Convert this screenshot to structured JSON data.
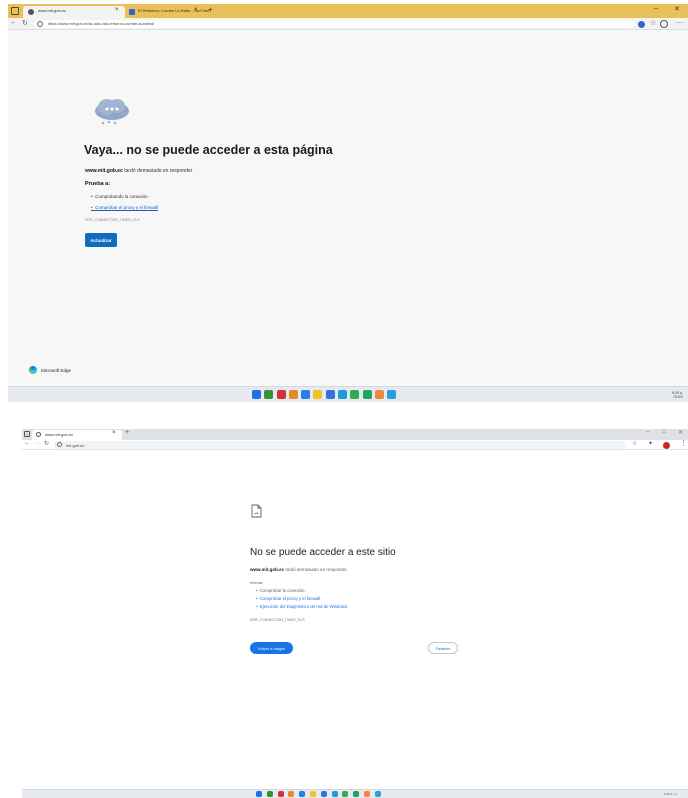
{
  "colors": {
    "edge_titlebar": "#e8c15a",
    "edge_button": "#0f6cbd",
    "chrome_button": "#1a73e8",
    "link": "#1a5fb4",
    "taskbar": "#e6e9ee"
  },
  "edge": {
    "tabs": [
      {
        "label": "www.mit.gob.ec",
        "icon": "globe-icon"
      },
      {
        "label": "El Refuerzo: Cumbe La Raba - YouTube",
        "icon": "tab-icon"
      }
    ],
    "address": "https://www.mit.gob.ec/la-ruta-vial-refuerzo-cumbe-la-batea/",
    "error": {
      "title": "Vaya... no se puede acceder a esta página",
      "host": "www.mit.gob.ec",
      "message": " tardó demasiado en responder",
      "try_label": "Prueba a:",
      "suggestions": [
        "Comprobando la conexión",
        "Comprobar el proxy y el firewall"
      ],
      "code": "ERR_CONNECTION_TIMED_OUT",
      "button": "Actualizar"
    },
    "brand": "Microsoft Edge",
    "clock": {
      "time": "9:29 a.",
      "date": "7/10/2"
    }
  },
  "chrome": {
    "tab_label": "www.mit.gob.ec",
    "address": "mit.gob.ec",
    "error": {
      "title": "No se puede acceder a este sitio",
      "host": "www.mit.gob.ec",
      "message": " tardó demasiado en responder.",
      "try_label": "Intenta:",
      "suggestions": [
        "Comprobar la conexión.",
        "Comprobar el proxy y el firewall.",
        "Ejecución del Diagnóstico de red de Windows."
      ],
      "code": "ERR_CONNECTION_TIMED_OUT",
      "reload_button": "Volver a cargar",
      "details_button": "Detalles"
    },
    "clock": "9:29 a. m."
  },
  "taskbar_icons": [
    {
      "name": "windows-start-icon",
      "color": "#1f6feb"
    },
    {
      "name": "search-icon",
      "color": "#3a8f3a"
    },
    {
      "name": "app-red-icon",
      "color": "#d13438"
    },
    {
      "name": "app-pin-icon",
      "color": "#e58a2b"
    },
    {
      "name": "app-blue-icon",
      "color": "#2b7be5"
    },
    {
      "name": "file-explorer-icon",
      "color": "#f2c027"
    },
    {
      "name": "store-icon",
      "color": "#3b6fd8"
    },
    {
      "name": "edge-icon",
      "color": "#1d9bd6"
    },
    {
      "name": "chrome-icon",
      "color": "#34a853"
    },
    {
      "name": "app-green-icon",
      "color": "#21a366"
    },
    {
      "name": "app-orange-icon",
      "color": "#f0883e"
    },
    {
      "name": "app-lightblue-icon",
      "color": "#2d9cdb"
    }
  ]
}
